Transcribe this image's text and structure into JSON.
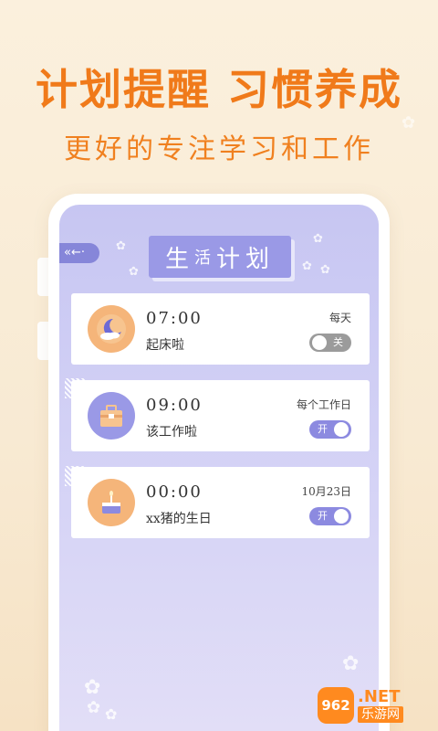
{
  "promo": {
    "headline": "计划提醒 习惯养成",
    "subline": "更好的专注学习和工作"
  },
  "screen": {
    "back_label": "«←·",
    "title_chars": [
      "生",
      "活",
      "计",
      "划"
    ],
    "alarms": [
      {
        "time": "07:00",
        "label": "起床啦",
        "repeat": "每天",
        "enabled": false,
        "toggle_label": "关",
        "icon": "moon-icon",
        "icon_color": "#f5b57a"
      },
      {
        "time": "09:00",
        "label": "该工作啦",
        "repeat": "每个工作日",
        "enabled": true,
        "toggle_label": "开",
        "icon": "briefcase-icon",
        "icon_color": "#9a99e6"
      },
      {
        "time": "00:00",
        "label": "xx猪的生日",
        "repeat": "10月23日",
        "enabled": true,
        "toggle_label": "开",
        "icon": "cake-icon",
        "icon_color": "#f5b57a"
      }
    ]
  },
  "watermark": {
    "logo": "962",
    "net": ".NET",
    "sub": "乐游网"
  },
  "colors": {
    "accent_orange": "#f07a1a",
    "screen_purple": "#c7c6f2",
    "toggle_on": "#8c8ae0",
    "toggle_off": "#9b9b9b"
  }
}
